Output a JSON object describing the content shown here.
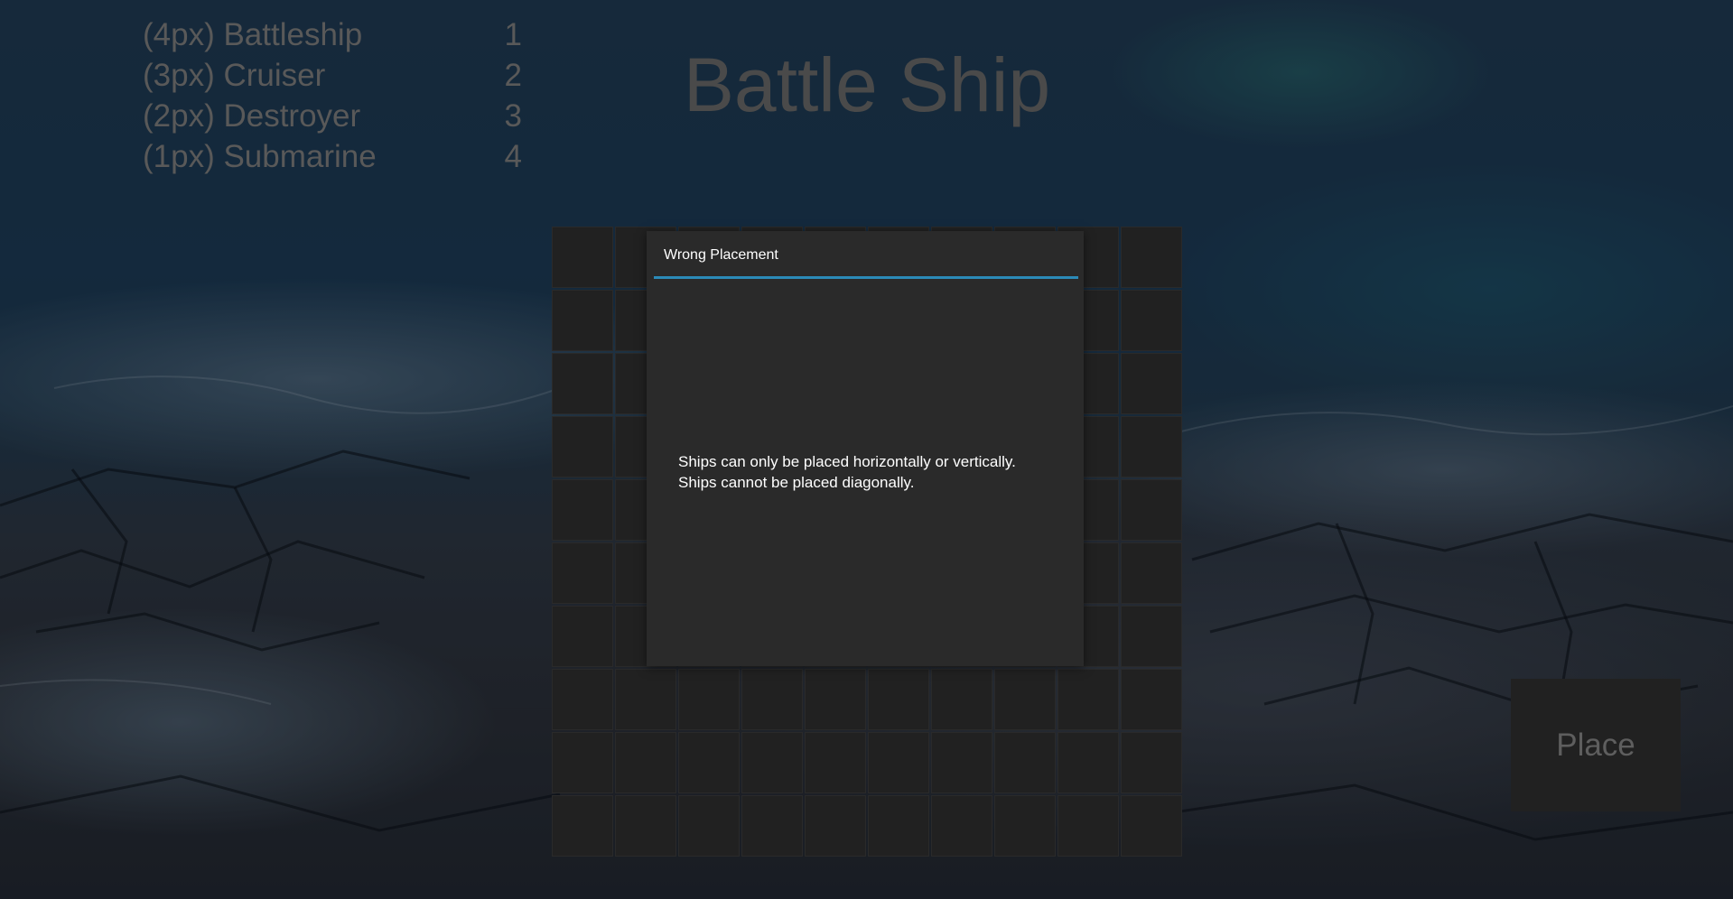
{
  "title": "Battle Ship",
  "ships": [
    {
      "label": "(4px) Battleship",
      "count": "1"
    },
    {
      "label": "(3px) Cruiser",
      "count": "2"
    },
    {
      "label": "(2px) Destroyer",
      "count": "3"
    },
    {
      "label": "(1px) Submarine",
      "count": "4"
    }
  ],
  "board": {
    "rows": 10,
    "cols": 10
  },
  "dialog": {
    "title": "Wrong Placement",
    "line1": "Ships can only be placed horizontally or vertically.",
    "line2": "Ships cannot be placed diagonally.",
    "accent_color": "#2b8ab8"
  },
  "place_button": {
    "label": "Place"
  }
}
